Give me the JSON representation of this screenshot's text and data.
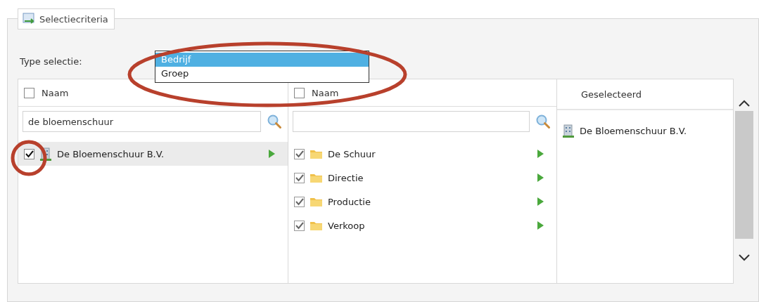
{
  "legend": {
    "title": "Selectiecriteria"
  },
  "type_selectie": {
    "label": "Type selectie:",
    "options": [
      {
        "label": "Bedrijf",
        "selected": true
      },
      {
        "label": "Groep",
        "selected": false
      }
    ]
  },
  "columns": [
    {
      "kind": "picker",
      "header": "Naam",
      "header_checked": false,
      "search_value": "de bloemenschuur",
      "items": [
        {
          "label": "De Bloemenschuur B.V.",
          "kind": "building",
          "checked": true,
          "selected": true
        }
      ]
    },
    {
      "kind": "picker",
      "header": "Naam",
      "header_checked": false,
      "items": [
        {
          "label": "De Schuur",
          "kind": "folder",
          "checked": true,
          "selected": false
        },
        {
          "label": "Directie",
          "kind": "folder",
          "checked": true,
          "selected": false
        },
        {
          "label": "Productie",
          "kind": "folder",
          "checked": true,
          "selected": false
        },
        {
          "label": "Verkoop",
          "kind": "folder",
          "checked": true,
          "selected": false
        }
      ]
    },
    {
      "kind": "list",
      "header": "Geselecteerd",
      "items": [
        {
          "label": "De Bloemenschuur B.V.",
          "kind": "building"
        }
      ]
    }
  ],
  "highlights": [
    {
      "kind": "ellipse"
    },
    {
      "kind": "circle"
    }
  ]
}
